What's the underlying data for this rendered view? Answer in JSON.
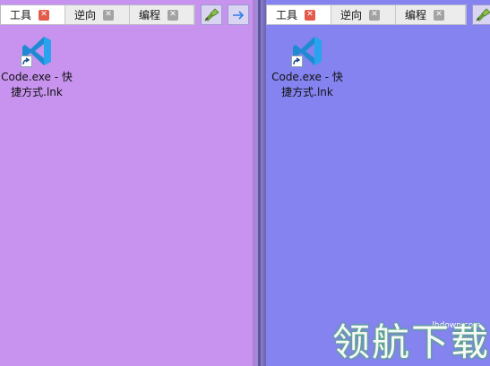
{
  "left_panel": {
    "background": "#c793ee",
    "tabs": [
      {
        "label": "工具",
        "active": true
      },
      {
        "label": "逆向",
        "active": false
      },
      {
        "label": "编程",
        "active": false
      }
    ],
    "toolbar": {
      "pin_icon": "pin-icon",
      "forward_icon": "arrow-right-icon"
    },
    "desktop_item": {
      "label": "Code.exe - 快\n捷方式.lnk",
      "icon": "vscode-icon"
    }
  },
  "right_panel": {
    "background": "#8483ef",
    "tabs": [
      {
        "label": "工具",
        "active": true
      },
      {
        "label": "逆向",
        "active": false
      },
      {
        "label": "编程",
        "active": false
      }
    ],
    "toolbar": {
      "pin_icon": "pin-icon"
    },
    "desktop_item": {
      "label": "Code.exe - 快\n捷方式.lnk",
      "icon": "vscode-icon"
    }
  },
  "watermark": {
    "url": "lhdown.com",
    "text": "领航下载"
  },
  "close_glyph": "✕"
}
